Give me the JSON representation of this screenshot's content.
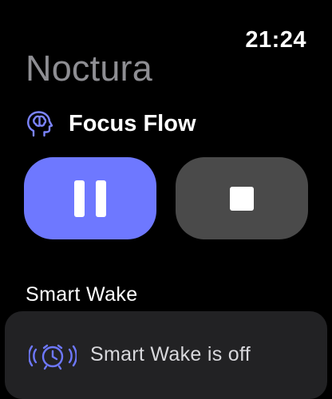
{
  "status_bar": {
    "time": "21:24"
  },
  "app": {
    "title": "Noctura"
  },
  "session": {
    "icon": "brain-icon",
    "name": "Focus Flow"
  },
  "controls": {
    "pause": {
      "icon": "pause-icon",
      "color": "#6e78ff"
    },
    "stop": {
      "icon": "stop-icon",
      "color": "#4a4a4a"
    }
  },
  "smart_wake": {
    "heading": "Smart Wake",
    "icon": "alarm-clock-icon",
    "icon_color": "#6e78ff",
    "status": "Smart Wake is off"
  }
}
